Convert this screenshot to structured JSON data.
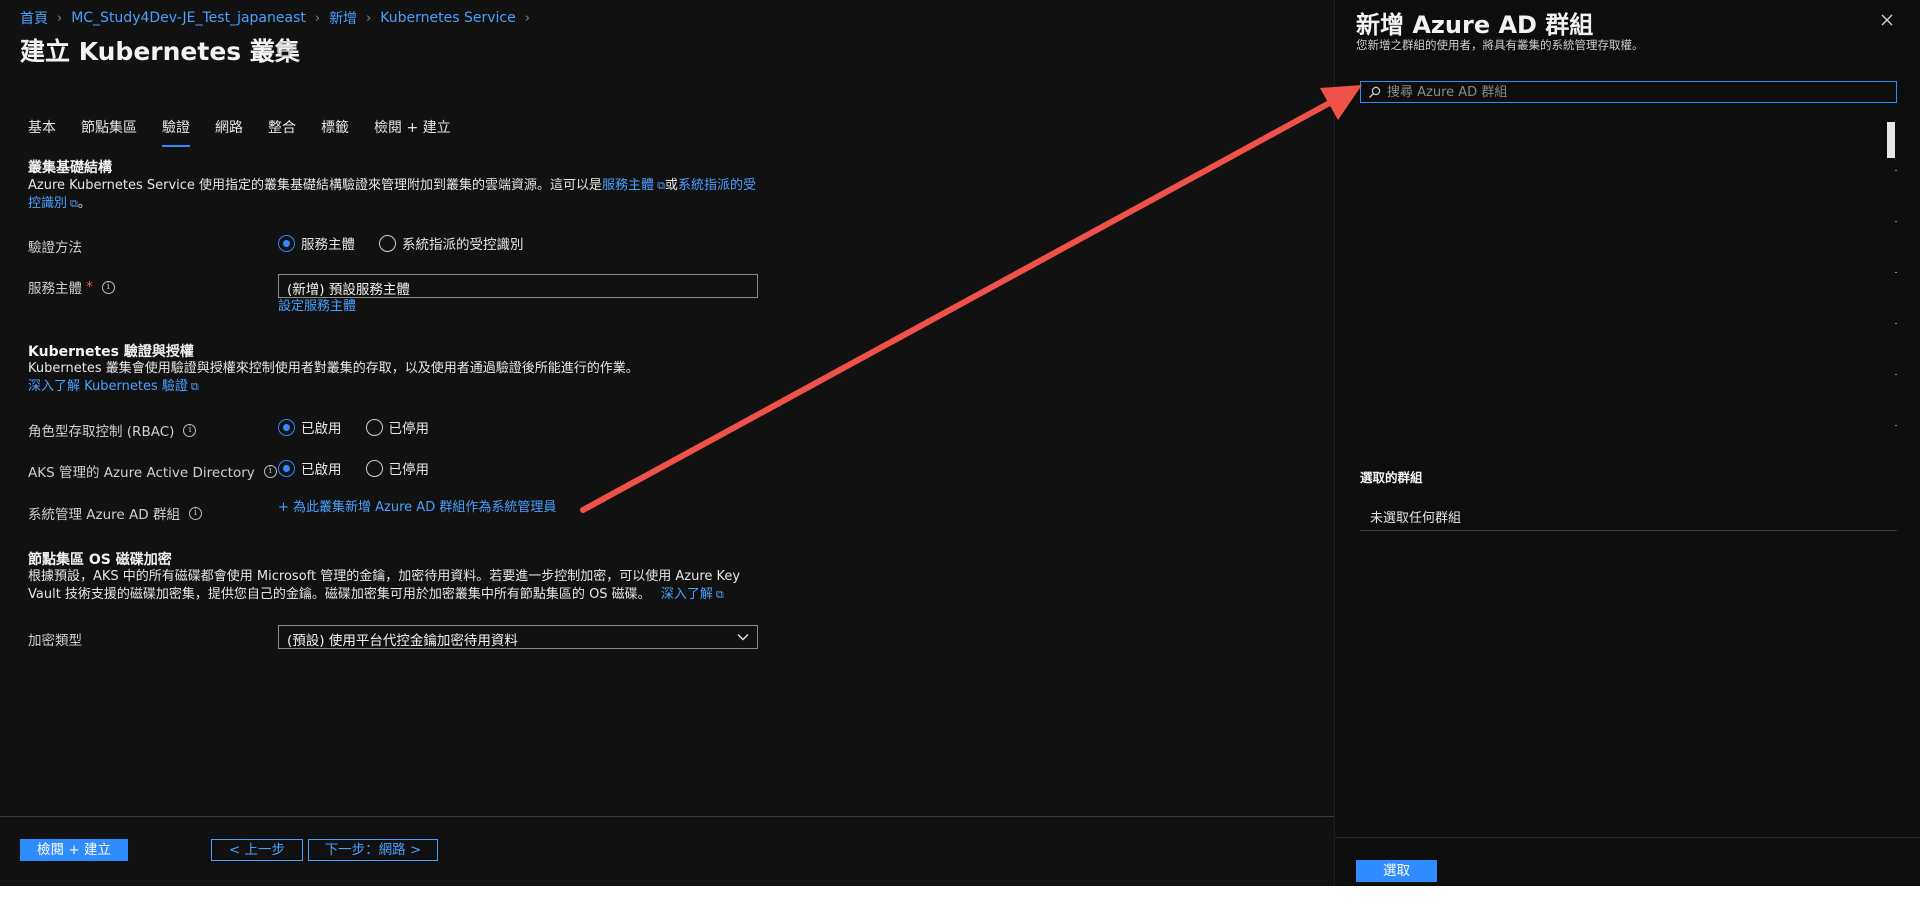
{
  "breadcrumb": {
    "items": [
      "首頁",
      "MC_Study4Dev-JE_Test_japaneast",
      "新增",
      "Kubernetes Service"
    ]
  },
  "page": {
    "title": "建立 Kubernetes 叢集"
  },
  "tabs": [
    {
      "label": "基本"
    },
    {
      "label": "節點集區"
    },
    {
      "label": "驗證",
      "active": true
    },
    {
      "label": "網路"
    },
    {
      "label": "整合"
    },
    {
      "label": "標籤"
    },
    {
      "label": "檢閱 + 建立"
    }
  ],
  "infra": {
    "title": "叢集基礎結構",
    "desc_prefix": "Azure Kubernetes Service 使用指定的叢集基礎結構驗證來管理附加到叢集的雲端資源。這可以是",
    "link1": "服務主體",
    "desc_mid": "或",
    "link2a": "系統指派的受",
    "link2b": "控識別",
    "desc_suffix": "。"
  },
  "auth_method": {
    "label": "驗證方法",
    "options": [
      "服務主體",
      "系統指派的受控識別"
    ],
    "selected": "服務主體"
  },
  "service_principal": {
    "label": "服務主體",
    "required": "*",
    "value": "(新增) 預設服務主體",
    "link": "設定服務主體"
  },
  "k8s_auth": {
    "title": "Kubernetes 驗證與授權",
    "desc": "Kubernetes 叢集會使用驗證與授權來控制使用者對叢集的存取，以及使用者通過驗證後所能進行的作業。",
    "link": "深入了解 Kubernetes 驗證"
  },
  "rbac": {
    "label": "角色型存取控制 (RBAC)",
    "options": [
      "已啟用",
      "已停用"
    ],
    "selected": "已啟用"
  },
  "aad": {
    "label": "AKS 管理的 Azure Active Directory",
    "options": [
      "已啟用",
      "已停用"
    ],
    "selected": "已啟用"
  },
  "admin_group": {
    "label": "系統管理 Azure AD 群組",
    "link": "+ 為此叢集新增 Azure AD 群組作為系統管理員"
  },
  "encryption": {
    "title": "節點集區 OS 磁碟加密",
    "desc_line1": "根據預設，AKS 中的所有磁碟都會使用 Microsoft 管理的金鑰，加密待用資料。若要進一步控制加密，可以使用 Azure Key",
    "desc_line2": "Vault 技術支援的磁碟加密集，提供您自己的金鑰。磁碟加密集可用於加密叢集中所有節點集區的 OS 磁碟。",
    "link": "深入了解",
    "type_label": "加密類型",
    "type_value": "(預設) 使用平台代控金鑰加密待用資料"
  },
  "footer": {
    "review_create": "檢閱 + 建立",
    "prev": "< 上一步",
    "next": "下一步：網路 >"
  },
  "panel": {
    "title": "新增 Azure AD 群組",
    "subtitle": "您新增之群組的使用者，將具有叢集的系統管理存取權。",
    "search_placeholder": "搜尋 Azure AD 群組",
    "selected_title": "選取的群組",
    "selected_none": "未選取任何群組",
    "select_button": "選取"
  },
  "colors": {
    "accent": "#2f8cff",
    "link": "#4aa0ff",
    "annotation_arrow": "#f0524a"
  }
}
